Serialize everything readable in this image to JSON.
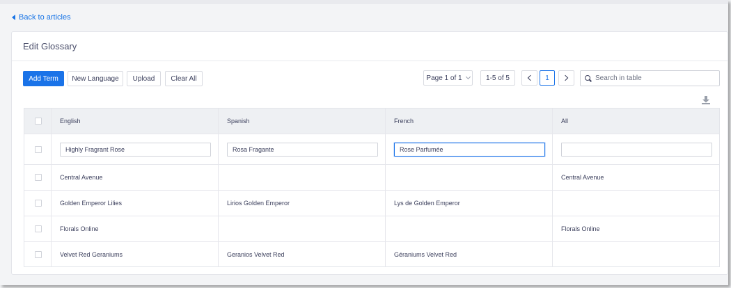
{
  "nav": {
    "back_label": "Back to articles"
  },
  "card": {
    "title": "Edit Glossary"
  },
  "toolbar": {
    "add_term": "Add Term",
    "new_language": "New Language",
    "upload": "Upload",
    "clear_all": "Clear All"
  },
  "pagination": {
    "page_select": "Page 1 of 1",
    "range": "1-5 of 5",
    "current_page": "1"
  },
  "search": {
    "placeholder": "Search in table"
  },
  "table": {
    "headers": [
      "English",
      "Spanish",
      "French",
      "All"
    ],
    "edit_row": [
      "Highly Fragrant Rose",
      "Rosa Fragante",
      "Rose Parfumée",
      ""
    ],
    "rows": [
      [
        "Central Avenue",
        "",
        "",
        "Central Avenue"
      ],
      [
        "Golden Emperor Lilies",
        "Lirios Golden Emperor",
        "Lys de Golden Emperor",
        ""
      ],
      [
        "Florals Online",
        "",
        "",
        "Florals Online"
      ],
      [
        "Velvet Red Geraniums",
        "Geranios Velvet Red",
        "Géraniums Velvet Red",
        ""
      ]
    ]
  },
  "colors": {
    "accent": "#1a73e8",
    "link": "#1874e6",
    "header_bg": "#eef0f3"
  },
  "icons": {
    "back": "caret-left-icon",
    "search": "search-icon",
    "download": "download-icon"
  }
}
